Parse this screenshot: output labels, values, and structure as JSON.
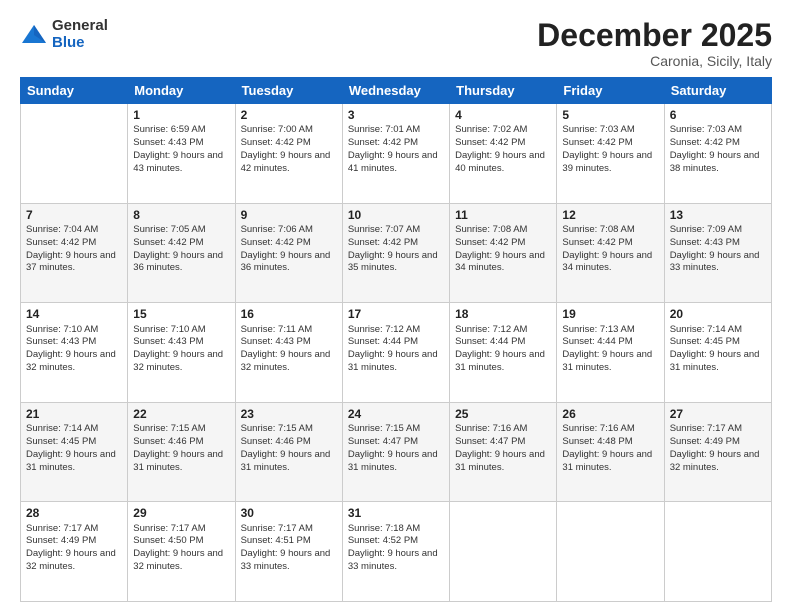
{
  "logo": {
    "general": "General",
    "blue": "Blue"
  },
  "header": {
    "month": "December 2025",
    "location": "Caronia, Sicily, Italy"
  },
  "weekdays": [
    "Sunday",
    "Monday",
    "Tuesday",
    "Wednesday",
    "Thursday",
    "Friday",
    "Saturday"
  ],
  "weeks": [
    [
      {
        "day": null,
        "content": null
      },
      {
        "day": "1",
        "sunrise": "Sunrise: 6:59 AM",
        "sunset": "Sunset: 4:43 PM",
        "daylight": "Daylight: 9 hours and 43 minutes."
      },
      {
        "day": "2",
        "sunrise": "Sunrise: 7:00 AM",
        "sunset": "Sunset: 4:42 PM",
        "daylight": "Daylight: 9 hours and 42 minutes."
      },
      {
        "day": "3",
        "sunrise": "Sunrise: 7:01 AM",
        "sunset": "Sunset: 4:42 PM",
        "daylight": "Daylight: 9 hours and 41 minutes."
      },
      {
        "day": "4",
        "sunrise": "Sunrise: 7:02 AM",
        "sunset": "Sunset: 4:42 PM",
        "daylight": "Daylight: 9 hours and 40 minutes."
      },
      {
        "day": "5",
        "sunrise": "Sunrise: 7:03 AM",
        "sunset": "Sunset: 4:42 PM",
        "daylight": "Daylight: 9 hours and 39 minutes."
      },
      {
        "day": "6",
        "sunrise": "Sunrise: 7:03 AM",
        "sunset": "Sunset: 4:42 PM",
        "daylight": "Daylight: 9 hours and 38 minutes."
      }
    ],
    [
      {
        "day": "7",
        "sunrise": "Sunrise: 7:04 AM",
        "sunset": "Sunset: 4:42 PM",
        "daylight": "Daylight: 9 hours and 37 minutes."
      },
      {
        "day": "8",
        "sunrise": "Sunrise: 7:05 AM",
        "sunset": "Sunset: 4:42 PM",
        "daylight": "Daylight: 9 hours and 36 minutes."
      },
      {
        "day": "9",
        "sunrise": "Sunrise: 7:06 AM",
        "sunset": "Sunset: 4:42 PM",
        "daylight": "Daylight: 9 hours and 36 minutes."
      },
      {
        "day": "10",
        "sunrise": "Sunrise: 7:07 AM",
        "sunset": "Sunset: 4:42 PM",
        "daylight": "Daylight: 9 hours and 35 minutes."
      },
      {
        "day": "11",
        "sunrise": "Sunrise: 7:08 AM",
        "sunset": "Sunset: 4:42 PM",
        "daylight": "Daylight: 9 hours and 34 minutes."
      },
      {
        "day": "12",
        "sunrise": "Sunrise: 7:08 AM",
        "sunset": "Sunset: 4:42 PM",
        "daylight": "Daylight: 9 hours and 34 minutes."
      },
      {
        "day": "13",
        "sunrise": "Sunrise: 7:09 AM",
        "sunset": "Sunset: 4:43 PM",
        "daylight": "Daylight: 9 hours and 33 minutes."
      }
    ],
    [
      {
        "day": "14",
        "sunrise": "Sunrise: 7:10 AM",
        "sunset": "Sunset: 4:43 PM",
        "daylight": "Daylight: 9 hours and 32 minutes."
      },
      {
        "day": "15",
        "sunrise": "Sunrise: 7:10 AM",
        "sunset": "Sunset: 4:43 PM",
        "daylight": "Daylight: 9 hours and 32 minutes."
      },
      {
        "day": "16",
        "sunrise": "Sunrise: 7:11 AM",
        "sunset": "Sunset: 4:43 PM",
        "daylight": "Daylight: 9 hours and 32 minutes."
      },
      {
        "day": "17",
        "sunrise": "Sunrise: 7:12 AM",
        "sunset": "Sunset: 4:44 PM",
        "daylight": "Daylight: 9 hours and 31 minutes."
      },
      {
        "day": "18",
        "sunrise": "Sunrise: 7:12 AM",
        "sunset": "Sunset: 4:44 PM",
        "daylight": "Daylight: 9 hours and 31 minutes."
      },
      {
        "day": "19",
        "sunrise": "Sunrise: 7:13 AM",
        "sunset": "Sunset: 4:44 PM",
        "daylight": "Daylight: 9 hours and 31 minutes."
      },
      {
        "day": "20",
        "sunrise": "Sunrise: 7:14 AM",
        "sunset": "Sunset: 4:45 PM",
        "daylight": "Daylight: 9 hours and 31 minutes."
      }
    ],
    [
      {
        "day": "21",
        "sunrise": "Sunrise: 7:14 AM",
        "sunset": "Sunset: 4:45 PM",
        "daylight": "Daylight: 9 hours and 31 minutes."
      },
      {
        "day": "22",
        "sunrise": "Sunrise: 7:15 AM",
        "sunset": "Sunset: 4:46 PM",
        "daylight": "Daylight: 9 hours and 31 minutes."
      },
      {
        "day": "23",
        "sunrise": "Sunrise: 7:15 AM",
        "sunset": "Sunset: 4:46 PM",
        "daylight": "Daylight: 9 hours and 31 minutes."
      },
      {
        "day": "24",
        "sunrise": "Sunrise: 7:15 AM",
        "sunset": "Sunset: 4:47 PM",
        "daylight": "Daylight: 9 hours and 31 minutes."
      },
      {
        "day": "25",
        "sunrise": "Sunrise: 7:16 AM",
        "sunset": "Sunset: 4:47 PM",
        "daylight": "Daylight: 9 hours and 31 minutes."
      },
      {
        "day": "26",
        "sunrise": "Sunrise: 7:16 AM",
        "sunset": "Sunset: 4:48 PM",
        "daylight": "Daylight: 9 hours and 31 minutes."
      },
      {
        "day": "27",
        "sunrise": "Sunrise: 7:17 AM",
        "sunset": "Sunset: 4:49 PM",
        "daylight": "Daylight: 9 hours and 32 minutes."
      }
    ],
    [
      {
        "day": "28",
        "sunrise": "Sunrise: 7:17 AM",
        "sunset": "Sunset: 4:49 PM",
        "daylight": "Daylight: 9 hours and 32 minutes."
      },
      {
        "day": "29",
        "sunrise": "Sunrise: 7:17 AM",
        "sunset": "Sunset: 4:50 PM",
        "daylight": "Daylight: 9 hours and 32 minutes."
      },
      {
        "day": "30",
        "sunrise": "Sunrise: 7:17 AM",
        "sunset": "Sunset: 4:51 PM",
        "daylight": "Daylight: 9 hours and 33 minutes."
      },
      {
        "day": "31",
        "sunrise": "Sunrise: 7:18 AM",
        "sunset": "Sunset: 4:52 PM",
        "daylight": "Daylight: 9 hours and 33 minutes."
      },
      {
        "day": null,
        "content": null
      },
      {
        "day": null,
        "content": null
      },
      {
        "day": null,
        "content": null
      }
    ]
  ]
}
